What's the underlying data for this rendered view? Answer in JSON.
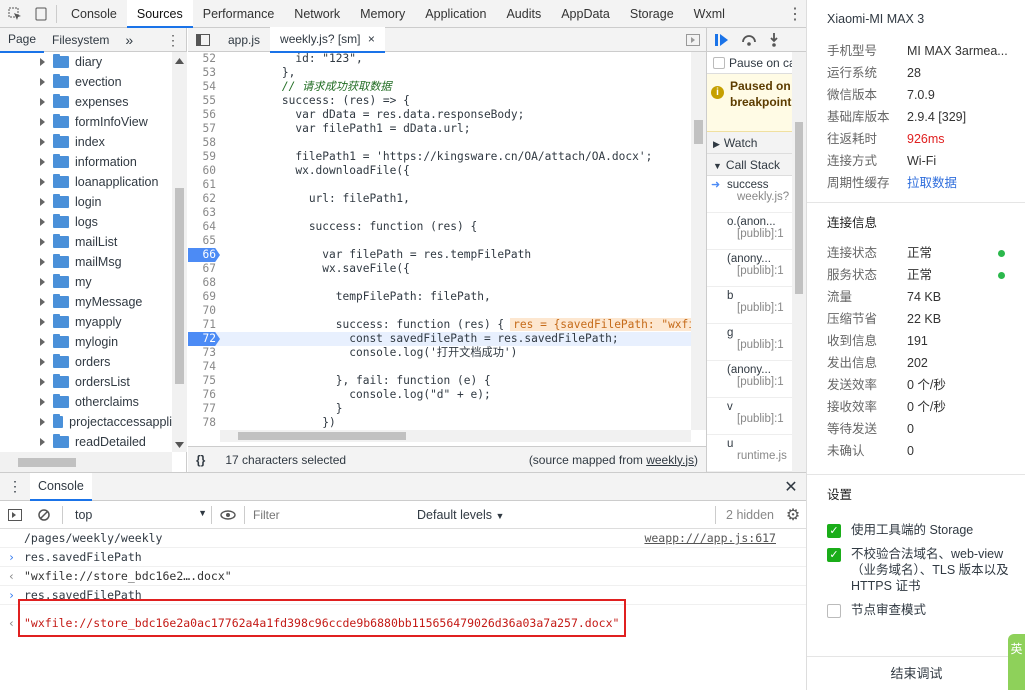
{
  "devtools_tabs": [
    "Console",
    "Sources",
    "Performance",
    "Network",
    "Memory",
    "Application",
    "Audits",
    "AppData",
    "Storage",
    "Wxml"
  ],
  "active_tab": "Sources",
  "nav": {
    "tabs": [
      "Page",
      "Filesystem"
    ],
    "more": "»",
    "folders": [
      "diary",
      "evection",
      "expenses",
      "formInfoView",
      "index",
      "information",
      "loanapplication",
      "login",
      "logs",
      "mailList",
      "mailMsg",
      "my",
      "myMessage",
      "myapply",
      "mylogin",
      "orders",
      "ordersList",
      "otherclaims",
      "projectaccessappli",
      "readDetailed"
    ]
  },
  "editor": {
    "tabs": [
      "app.js",
      "weekly.js? [sm]"
    ],
    "close": "×",
    "lines": [
      {
        "n": "52",
        "t": "          id: \"123\",",
        "cls": ""
      },
      {
        "n": "53",
        "t": "        },",
        "cls": ""
      },
      {
        "n": "54",
        "t": "        // 请求成功获取数据",
        "cls": "cm"
      },
      {
        "n": "55",
        "t": "        success: (res) => {",
        "cls": ""
      },
      {
        "n": "56",
        "t": "          var dData = res.data.responseBody;",
        "cls": ""
      },
      {
        "n": "57",
        "t": "          var filePath1 = dData.url;",
        "cls": ""
      },
      {
        "n": "58",
        "t": "",
        "cls": ""
      },
      {
        "n": "59",
        "t": "          filePath1 = 'https://kingsware.cn/OA/attach/OA.docx';",
        "cls": ""
      },
      {
        "n": "60",
        "t": "          wx.downloadFile({",
        "cls": ""
      },
      {
        "n": "61",
        "t": "",
        "cls": ""
      },
      {
        "n": "62",
        "t": "            url: filePath1,",
        "cls": ""
      },
      {
        "n": "63",
        "t": "",
        "cls": ""
      },
      {
        "n": "64",
        "t": "            success: function (res) {",
        "cls": ""
      },
      {
        "n": "65",
        "t": "",
        "cls": ""
      },
      {
        "n": "66",
        "t": "              var filePath = res.tempFilePath",
        "cls": "bp"
      },
      {
        "n": "67",
        "t": "              wx.saveFile({",
        "cls": ""
      },
      {
        "n": "68",
        "t": "",
        "cls": ""
      },
      {
        "n": "69",
        "t": "                tempFilePath: filePath,",
        "cls": ""
      },
      {
        "n": "70",
        "t": "",
        "cls": ""
      },
      {
        "n": "71",
        "t": "                success: function (res) {",
        "cls": "",
        "inline": "res = {savedFilePath: \"wxfil"
      },
      {
        "n": "72",
        "t": "                  const savedFilePath = res.savedFilePath;",
        "cls": "bp hl"
      },
      {
        "n": "73",
        "t": "                  console.log('打开文档成功')",
        "cls": ""
      },
      {
        "n": "74",
        "t": "",
        "cls": ""
      },
      {
        "n": "75",
        "t": "                }, fail: function (e) {",
        "cls": ""
      },
      {
        "n": "76",
        "t": "                  console.log(\"d\" + e);",
        "cls": ""
      },
      {
        "n": "77",
        "t": "                }",
        "cls": ""
      },
      {
        "n": "78",
        "t": "              })",
        "cls": ""
      },
      {
        "n": "79",
        "t": "",
        "cls": ""
      }
    ],
    "status_icon": "{}",
    "status": "17 characters selected",
    "mapped_prefix": "(source mapped from ",
    "mapped_link": "weekly.js",
    "mapped_suffix": ")"
  },
  "debugger": {
    "pause_on": "Pause on ca...",
    "paused": "Paused on breakpoint",
    "watch": "Watch",
    "call_stack": "Call Stack",
    "frames": [
      {
        "fn": "success",
        "loc": "weekly.js?"
      },
      {
        "fn": "o.(anon...",
        "loc": "[publib]:1"
      },
      {
        "fn": "(anony...",
        "loc": "[publib]:1"
      },
      {
        "fn": "b",
        "loc": "[publib]:1"
      },
      {
        "fn": "g",
        "loc": "[publib]:1"
      },
      {
        "fn": "(anony...",
        "loc": "[publib]:1"
      },
      {
        "fn": "v",
        "loc": "[publib]:1"
      },
      {
        "fn": "u",
        "loc": "runtime.js"
      }
    ]
  },
  "console": {
    "tab": "Console",
    "context": "top",
    "filter_placeholder": "Filter",
    "levels": "Default levels",
    "hidden": "2 hidden",
    "rows": [
      {
        "type": "log",
        "text": "/pages/weekly/weekly",
        "link": "weapp:///app.js:617"
      },
      {
        "type": "in",
        "text": "res.savedFilePath"
      },
      {
        "type": "out",
        "text": "\"wxfile://store_bdc16e2….docx\""
      },
      {
        "type": "in",
        "text": "res.savedFilePath"
      },
      {
        "type": "out",
        "text": "\"wxfile://store_bdc16e2a0ac17762a4a1fd398c96ccde9b6880bb115656479026d36a03a7a257.docx\""
      }
    ]
  },
  "device": {
    "title": "Xiaomi-MI MAX 3",
    "info": [
      {
        "k": "手机型号",
        "v": "MI MAX 3armea..."
      },
      {
        "k": "运行系统",
        "v": "28"
      },
      {
        "k": "微信版本",
        "v": "7.0.9"
      },
      {
        "k": "基础库版本",
        "v": "2.9.4 [329]"
      },
      {
        "k": "往返耗时",
        "v": "926ms",
        "color": "#e02020"
      },
      {
        "k": "连接方式",
        "v": "Wi-Fi"
      },
      {
        "k": "周期性缓存",
        "v": "拉取数据",
        "color": "#2e6ddc"
      }
    ],
    "conn_title": "连接信息",
    "conn": [
      {
        "k": "连接状态",
        "v": "正常",
        "dot": true
      },
      {
        "k": "服务状态",
        "v": "正常",
        "dot": true
      },
      {
        "k": "流量",
        "v": "74 KB"
      },
      {
        "k": "压缩节省",
        "v": "22 KB"
      },
      {
        "k": "收到信息",
        "v": "191"
      },
      {
        "k": "发出信息",
        "v": "202"
      },
      {
        "k": "发送效率",
        "v": "0 个/秒"
      },
      {
        "k": "接收效率",
        "v": "0 个/秒"
      },
      {
        "k": "等待发送",
        "v": "0"
      },
      {
        "k": "未确认",
        "v": "0"
      }
    ],
    "settings_title": "设置",
    "settings": [
      {
        "label": "使用工具端的 Storage",
        "checked": true
      },
      {
        "label": "不校验合法域名、web-view（业务域名）、TLS 版本以及 HTTPS 证书",
        "checked": true
      },
      {
        "label": "节点审查模式",
        "checked": false
      }
    ],
    "end_button": "结束调试",
    "corner_text": "英"
  },
  "colors": {
    "accent": "#1a73e8",
    "breakpoint": "#4c8bf5",
    "highlight_box": "#e02020",
    "ok_dot": "#2bb84c",
    "checkbox": "#1aad19"
  }
}
